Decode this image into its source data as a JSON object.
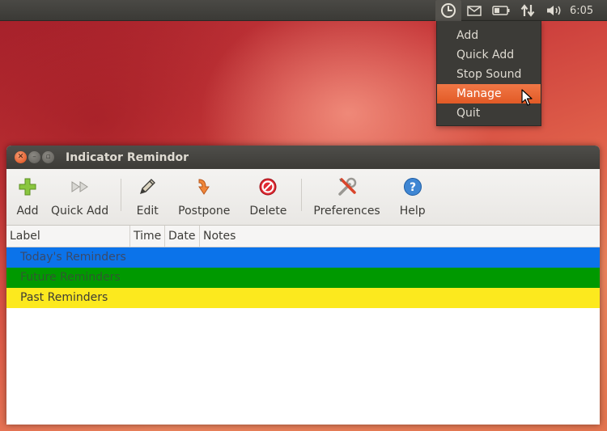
{
  "panel": {
    "time": "6:05",
    "indicators": [
      "clock-icon",
      "mail-icon",
      "battery-icon",
      "network-icon",
      "volume-icon"
    ]
  },
  "menu": {
    "items": [
      {
        "label": "Add",
        "active": false
      },
      {
        "label": "Quick Add",
        "active": false
      },
      {
        "label": "Stop Sound",
        "active": false
      },
      {
        "label": "Manage",
        "active": true
      },
      {
        "label": "Quit",
        "active": false
      }
    ]
  },
  "window": {
    "title": "Indicator Remindor",
    "toolbar": {
      "add": "Add",
      "quick_add": "Quick Add",
      "edit": "Edit",
      "postpone": "Postpone",
      "delete": "Delete",
      "preferences": "Preferences",
      "help": "Help"
    },
    "columns": {
      "label": "Label",
      "time": "Time",
      "date": "Date",
      "notes": "Notes"
    },
    "groups": [
      {
        "label": "Today's Reminders",
        "color": "#0b73ea"
      },
      {
        "label": "Future Reminders",
        "color": "#009900"
      },
      {
        "label": "Past Reminders",
        "color": "#fce91e"
      }
    ]
  },
  "colors": {
    "accent": "#e25a26",
    "panel": "#3c3b37"
  }
}
